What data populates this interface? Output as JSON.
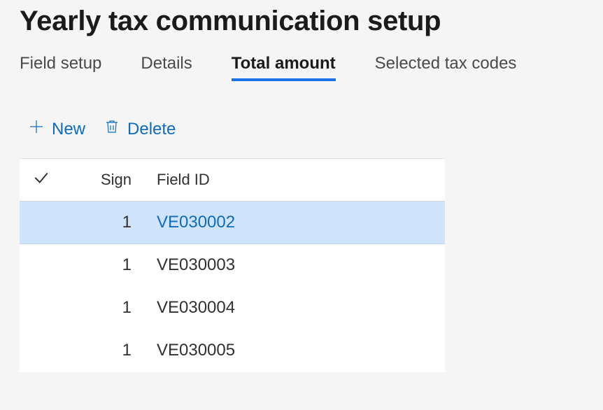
{
  "header": {
    "title": "Yearly tax communication setup"
  },
  "tabs": [
    {
      "label": "Field setup",
      "active": false
    },
    {
      "label": "Details",
      "active": false
    },
    {
      "label": "Total amount",
      "active": true
    },
    {
      "label": "Selected tax codes",
      "active": false
    }
  ],
  "toolbar": {
    "new_label": "New",
    "delete_label": "Delete"
  },
  "grid": {
    "columns": {
      "sign": "Sign",
      "field_id": "Field ID"
    },
    "rows": [
      {
        "sign": "1",
        "field_id": "VE030002",
        "selected": true
      },
      {
        "sign": "1",
        "field_id": "VE030003",
        "selected": false
      },
      {
        "sign": "1",
        "field_id": "VE030004",
        "selected": false
      },
      {
        "sign": "1",
        "field_id": "VE030005",
        "selected": false
      }
    ]
  }
}
